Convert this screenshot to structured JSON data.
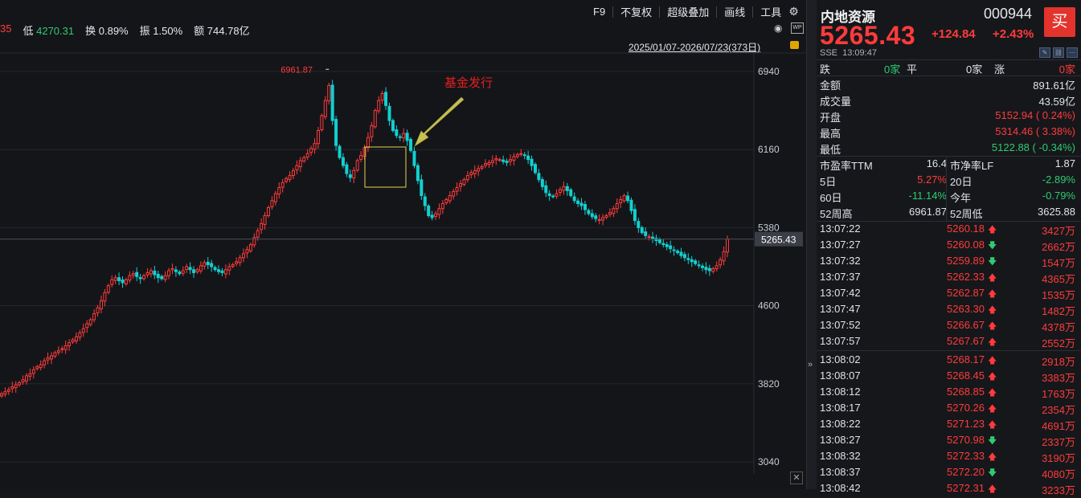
{
  "toolbar": {
    "items": [
      "F9",
      "不复权",
      "超级叠加",
      "画线",
      "工具"
    ],
    "gear_icon": "gear-icon",
    "next_icon": "chevron-right-icon"
  },
  "info_bar": {
    "fragment": "35",
    "low_label": "低",
    "low_value": "4270.31",
    "turnover_label": "换",
    "turnover_value": "0.89%",
    "amplitude_label": "振",
    "amplitude_value": "1.50%",
    "amount_label": "额",
    "amount_value": "744.78亿"
  },
  "date_range": "2025/01/07-2026/07/23(373日)",
  "chart_data": {
    "type": "candlestick",
    "y_ticks": [
      6940,
      6160,
      5380,
      4600,
      3820,
      3040
    ],
    "ylim": [
      3040,
      6940
    ],
    "current_price_label": "5265.43",
    "max_label": "6961.87",
    "annotation": "基金发行",
    "colors": {
      "up": "#ff3b3b",
      "down": "#12d0d0",
      "annotation": "#e02020",
      "box": "#e6d44a",
      "arrow": "#c8c050"
    },
    "approx_closes": [
      3720,
      3740,
      3760,
      3790,
      3810,
      3830,
      3860,
      3900,
      3920,
      3960,
      3990,
      4010,
      4050,
      4080,
      4100,
      4130,
      4150,
      4170,
      4200,
      4230,
      4260,
      4290,
      4330,
      4370,
      4420,
      4460,
      4520,
      4580,
      4650,
      4730,
      4800,
      4860,
      4880,
      4850,
      4830,
      4860,
      4900,
      4920,
      4890,
      4870,
      4900,
      4930,
      4950,
      4910,
      4880,
      4870,
      4900,
      4950,
      4970,
      4940,
      4920,
      4950,
      4990,
      4960,
      4930,
      4960,
      5000,
      5030,
      5010,
      4990,
      4960,
      4940,
      4930,
      4960,
      4990,
      5010,
      5040,
      5080,
      5120,
      5160,
      5210,
      5280,
      5350,
      5420,
      5500,
      5580,
      5650,
      5720,
      5780,
      5830,
      5870,
      5900,
      5950,
      6000,
      6050,
      6080,
      6120,
      6170,
      6220,
      6350,
      6500,
      6650,
      6800,
      6450,
      6200,
      6080,
      6000,
      5920,
      5880,
      5950,
      6050,
      6100,
      6180,
      6280,
      6400,
      6550,
      6650,
      6720,
      6600,
      6450,
      6350,
      6300,
      6280,
      6320,
      6250,
      6150,
      6000,
      5850,
      5700,
      5600,
      5500,
      5480,
      5520,
      5570,
      5620,
      5660,
      5700,
      5740,
      5780,
      5820,
      5860,
      5900,
      5930,
      5950,
      5970,
      5990,
      6020,
      6030,
      6050,
      6070,
      6060,
      6040,
      6030,
      6060,
      6090,
      6110,
      6120,
      6100,
      6060,
      6000,
      5930,
      5860,
      5790,
      5730,
      5700,
      5690,
      5720,
      5760,
      5790,
      5750,
      5700,
      5650,
      5620,
      5600,
      5560,
      5520,
      5490,
      5470,
      5460,
      5480,
      5500,
      5530,
      5570,
      5620,
      5660,
      5700,
      5650,
      5550,
      5450,
      5380,
      5330,
      5300,
      5290,
      5270,
      5250,
      5230,
      5210,
      5190,
      5170,
      5150,
      5130,
      5100,
      5080,
      5060,
      5040,
      5020,
      5000,
      4980,
      4960,
      4950,
      4970,
      5000,
      5060,
      5140,
      5265
    ]
  },
  "quote": {
    "name": "内地资源",
    "code": "000944",
    "buy": "买",
    "price": "5265.43",
    "change": "+124.84",
    "change_pct": "+2.43%",
    "market": "SSE",
    "time": "13:09:47",
    "breadth": {
      "fall_label": "跌",
      "fall_value": "0家",
      "flat_label": "平",
      "flat_value": "0家",
      "rise_label": "涨",
      "rise_value": "0家"
    },
    "stats": [
      {
        "label": "金额",
        "value": "891.61亿",
        "color": "#e0e3e8"
      },
      {
        "label": "成交量",
        "value": "43.59亿",
        "color": "#e0e3e8"
      },
      {
        "label": "开盘",
        "value": "5152.94 ( 0.24%)",
        "color": "#ff3b3b"
      },
      {
        "label": "最高",
        "value": "5314.46 ( 3.38%)",
        "color": "#ff3b3b"
      },
      {
        "label": "最低",
        "value": "5122.88 ( -0.34%)",
        "color": "#2ecc71"
      }
    ],
    "metrics": [
      {
        "l1": "市盈率TTM",
        "v1": "16.4",
        "c1": "#e0e3e8",
        "l2": "市净率LF",
        "v2": "1.87",
        "c2": "#e0e3e8"
      },
      {
        "l1": "5日",
        "v1": "5.27%",
        "c1": "#ff3b3b",
        "l2": "20日",
        "v2": "-2.89%",
        "c2": "#2ecc71"
      },
      {
        "l1": "60日",
        "v1": "-11.14%",
        "c1": "#2ecc71",
        "l2": "今年",
        "v2": "-0.79%",
        "c2": "#2ecc71"
      },
      {
        "l1": "52周高",
        "v1": "6961.87",
        "c1": "#e0e3e8",
        "l2": "52周低",
        "v2": "3625.88",
        "c2": "#e0e3e8"
      }
    ],
    "ticks": [
      {
        "time": "13:07:22",
        "price": "5260.18",
        "dir": "up",
        "vol": "3427万"
      },
      {
        "time": "13:07:27",
        "price": "5260.08",
        "dir": "down",
        "vol": "2662万"
      },
      {
        "time": "13:07:32",
        "price": "5259.89",
        "dir": "down",
        "vol": "1547万"
      },
      {
        "time": "13:07:37",
        "price": "5262.33",
        "dir": "up",
        "vol": "4365万"
      },
      {
        "time": "13:07:42",
        "price": "5262.87",
        "dir": "up",
        "vol": "1535万"
      },
      {
        "time": "13:07:47",
        "price": "5263.30",
        "dir": "up",
        "vol": "1482万"
      },
      {
        "time": "13:07:52",
        "price": "5266.67",
        "dir": "up",
        "vol": "4378万"
      },
      {
        "time": "13:07:57",
        "price": "5267.67",
        "dir": "up",
        "vol": "2552万"
      },
      {
        "time": "13:08:02",
        "price": "5268.17",
        "dir": "up",
        "vol": "2918万"
      },
      {
        "time": "13:08:07",
        "price": "5268.45",
        "dir": "up",
        "vol": "3383万"
      },
      {
        "time": "13:08:12",
        "price": "5268.85",
        "dir": "up",
        "vol": "1763万"
      },
      {
        "time": "13:08:17",
        "price": "5270.26",
        "dir": "up",
        "vol": "2354万"
      },
      {
        "time": "13:08:22",
        "price": "5271.23",
        "dir": "up",
        "vol": "4691万"
      },
      {
        "time": "13:08:27",
        "price": "5270.98",
        "dir": "down",
        "vol": "2337万"
      },
      {
        "time": "13:08:32",
        "price": "5272.33",
        "dir": "up",
        "vol": "3190万"
      },
      {
        "time": "13:08:37",
        "price": "5272.20",
        "dir": "down",
        "vol": "4080万"
      },
      {
        "time": "13:08:42",
        "price": "5272.31",
        "dir": "up",
        "vol": "3233万"
      }
    ]
  }
}
